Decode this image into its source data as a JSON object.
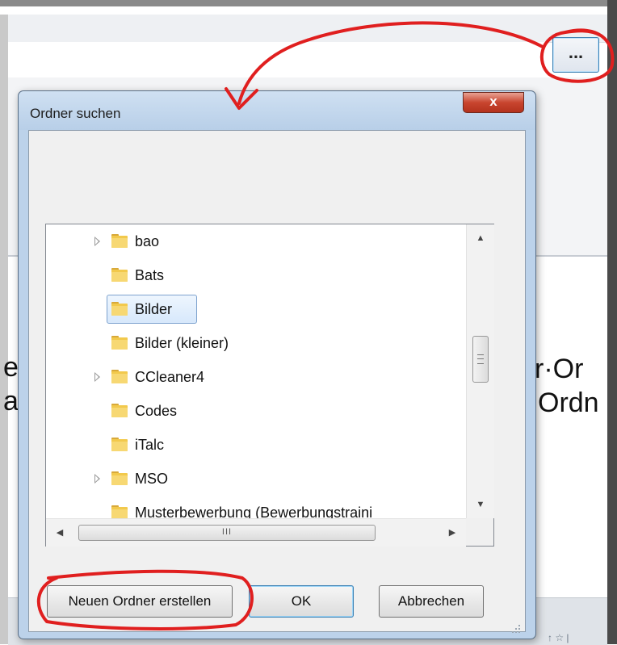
{
  "background_app": {
    "browse_button_label": "...",
    "doc_text_line1": "r·Or",
    "doc_text_line2": "Ordn"
  },
  "dialog": {
    "title": "Ordner suchen",
    "close_label": "x",
    "tree": {
      "items": [
        {
          "label": "bao",
          "expandable": true,
          "selected": false
        },
        {
          "label": "Bats",
          "expandable": false,
          "selected": false
        },
        {
          "label": "Bilder",
          "expandable": false,
          "selected": true
        },
        {
          "label": "Bilder (kleiner)",
          "expandable": false,
          "selected": false
        },
        {
          "label": "CCleaner4",
          "expandable": true,
          "selected": false
        },
        {
          "label": "Codes",
          "expandable": false,
          "selected": false
        },
        {
          "label": "iTalc",
          "expandable": false,
          "selected": false
        },
        {
          "label": "MSO",
          "expandable": true,
          "selected": false
        },
        {
          "label": "Musterbewerbung (Bewerbungstraini",
          "expandable": false,
          "selected": false
        }
      ],
      "hscroll_thumb_label": "III"
    },
    "buttons": {
      "new_folder": "Neuen Ordner erstellen",
      "ok": "OK",
      "cancel": "Abbrechen"
    }
  },
  "colors": {
    "annotation_red": "#e01f1f",
    "dialog_frame": "#bcd2ea",
    "close_button": "#c9452f",
    "folder_yellow": "#f2c94c"
  }
}
